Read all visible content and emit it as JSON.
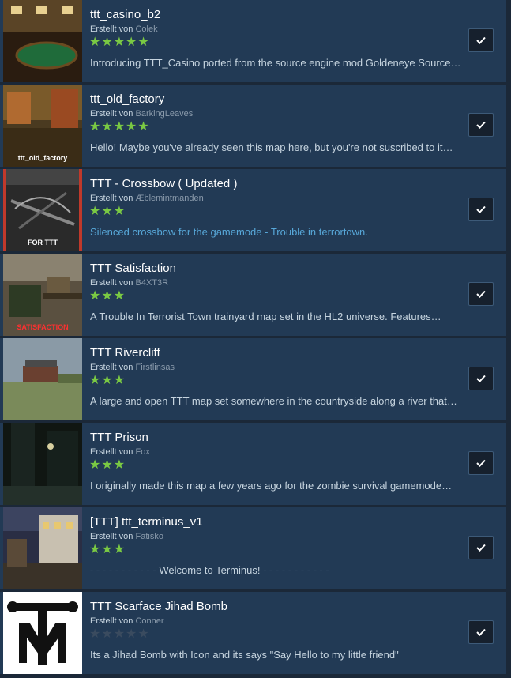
{
  "labels": {
    "created_by": "Erstellt von"
  },
  "items": [
    {
      "title": "ttt_casino_b2",
      "author": "Colek",
      "stars": 5,
      "desc": "Introducing TTT_Casino ported from the source engine mod Goldeneye Source…",
      "desc_link": false,
      "thumb_label": ""
    },
    {
      "title": "ttt_old_factory",
      "author": "BarkingLeaves",
      "stars": 5,
      "desc": "Hello! Maybe you've already seen this map here, but you're not suscribed to it…",
      "desc_link": false,
      "thumb_label": "ttt_old_factory"
    },
    {
      "title": "TTT - Crossbow ( Updated )",
      "author": "Æblemintmanden",
      "stars": 3,
      "desc": "Silenced crossbow for the gamemode - Trouble in terrortown.",
      "desc_link": true,
      "thumb_label": "FOR TTT"
    },
    {
      "title": "TTT Satisfaction",
      "author": "B4XT3R",
      "stars": 3,
      "desc": "A Trouble In Terrorist Town trainyard map set in the HL2 universe. Features…",
      "desc_link": false,
      "thumb_label": "SATISFACTION"
    },
    {
      "title": "TTT Rivercliff",
      "author": "Firstlinsas",
      "stars": 3,
      "desc": "A large and open TTT map set somewhere in the countryside along a river that…",
      "desc_link": false,
      "thumb_label": ""
    },
    {
      "title": "TTT Prison",
      "author": "Fox",
      "stars": 3,
      "desc": "I originally made this map a few years ago for the zombie survival gamemode…",
      "desc_link": false,
      "thumb_label": ""
    },
    {
      "title": "[TTT] ttt_terminus_v1",
      "author": "Fatisko",
      "stars": 3,
      "desc": "- - - - - - - - - - - Welcome to Terminus! - - - - - - - - - - -",
      "desc_link": false,
      "thumb_label": ""
    },
    {
      "title": "TTT Scarface Jihad Bomb",
      "author": "Conner",
      "stars": 0,
      "desc": "Its a Jihad Bomb with Icon and its says \"Say Hello to my little friend\"",
      "desc_link": false,
      "thumb_label": ""
    }
  ],
  "check_icon": "checkmark-icon",
  "colors": {
    "background": "#1b2838",
    "row": "#223a55",
    "star_on": "#7ac943",
    "star_off": "#3a4b5f",
    "link": "#57a7d8"
  }
}
